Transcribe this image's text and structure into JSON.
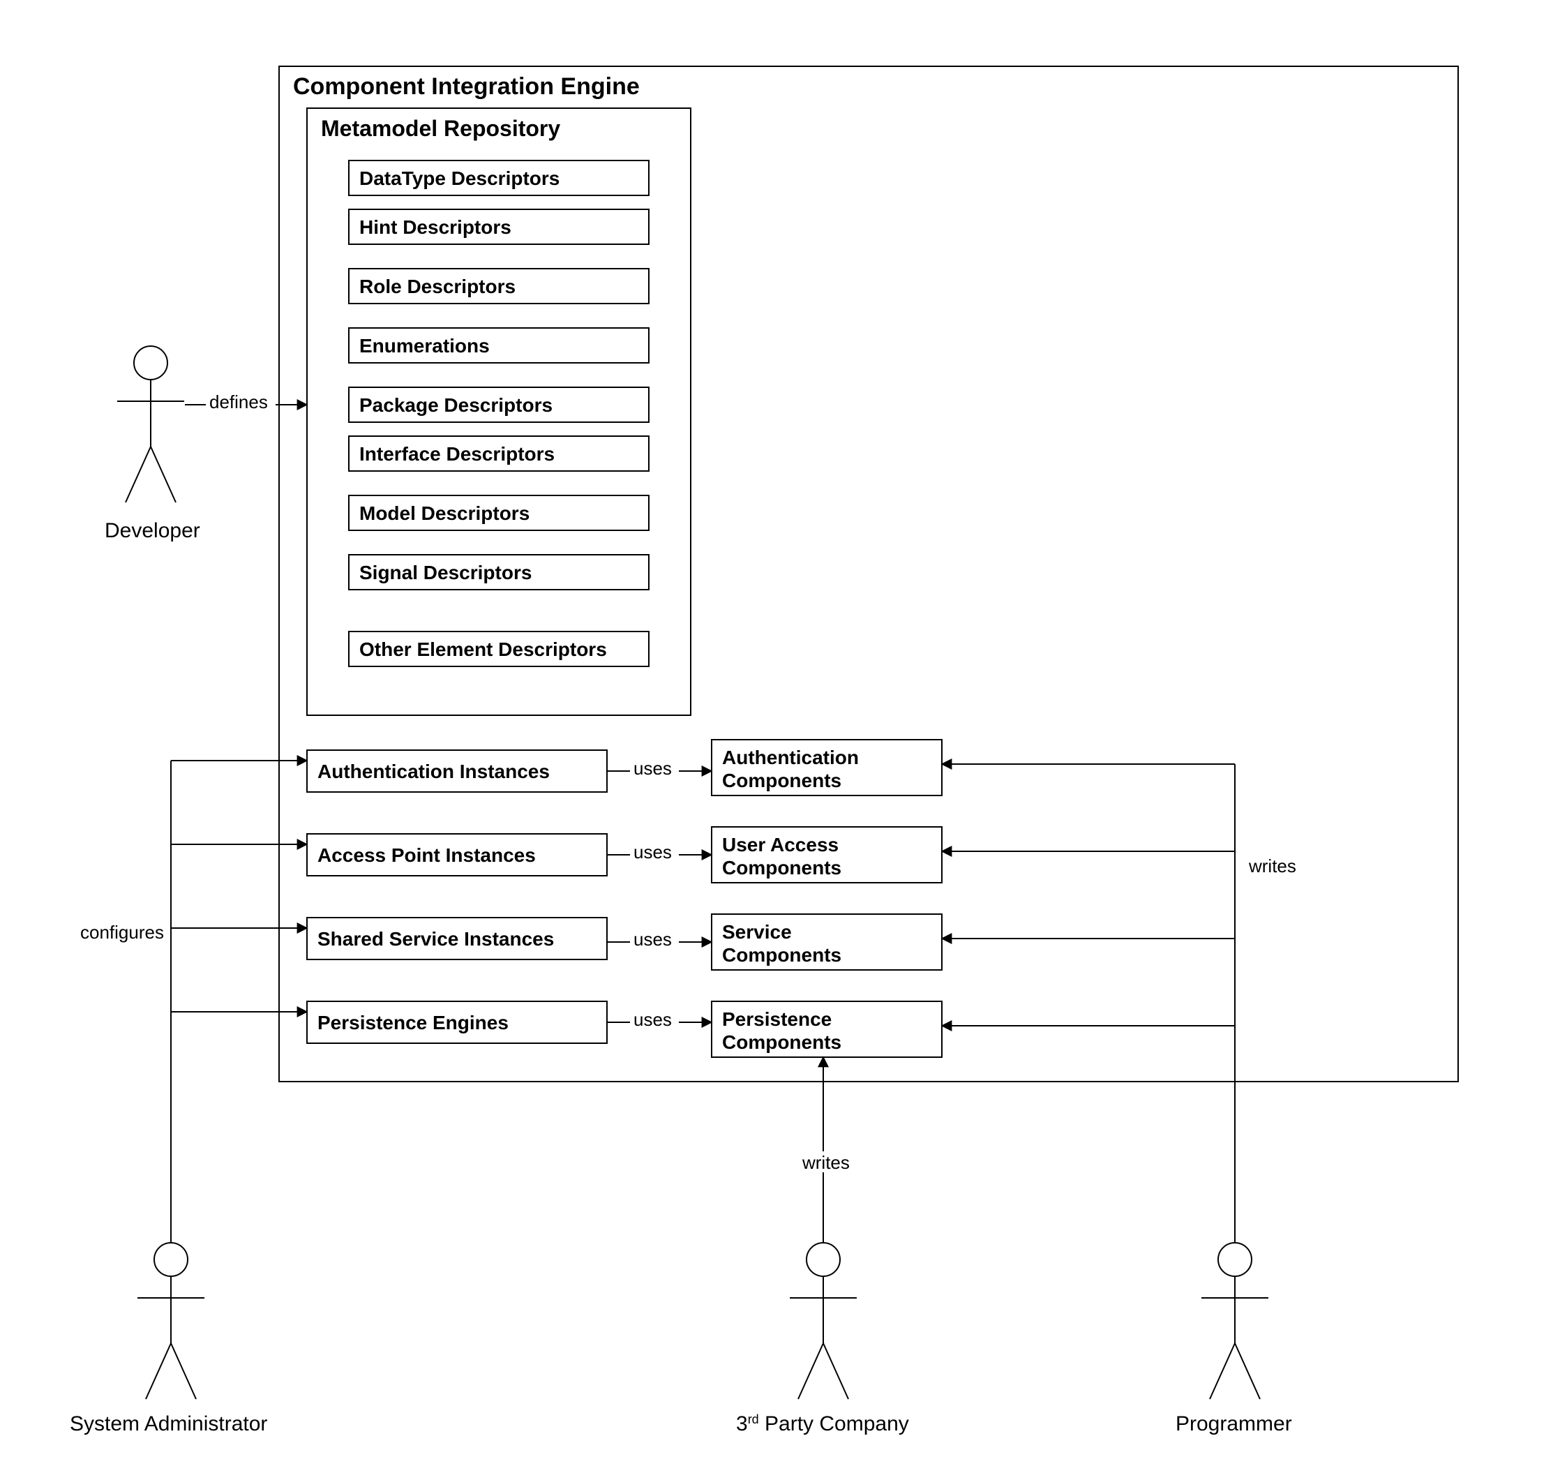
{
  "engine": {
    "title": "Component Integration Engine"
  },
  "repo": {
    "title": "Metamodel Repository"
  },
  "descriptors": [
    "DataType Descriptors",
    "Hint Descriptors",
    "Role Descriptors",
    "Enumerations",
    "Package Descriptors",
    "Interface Descriptors",
    "Model Descriptors",
    "Signal Descriptors",
    "Other Element Descriptors"
  ],
  "instanceBoxes": [
    "Authentication Instances",
    "Access Point Instances",
    "Shared Service Instances",
    "Persistence Engines"
  ],
  "componentBoxes": [
    {
      "l1": "Authentication",
      "l2": "Components"
    },
    {
      "l1": "User Access",
      "l2": "Components"
    },
    {
      "l1": "Service",
      "l2": "Components"
    },
    {
      "l1": "Persistence",
      "l2": "Components"
    }
  ],
  "relations": {
    "defines": "defines",
    "uses": "uses",
    "configures": "configures",
    "writes": "writes"
  },
  "actors": {
    "developer": "Developer",
    "sysadmin": "System Administrator",
    "thirdparty_pre": "3",
    "thirdparty_sup": "rd",
    "thirdparty_post": " Party Company",
    "programmer": "Programmer"
  }
}
